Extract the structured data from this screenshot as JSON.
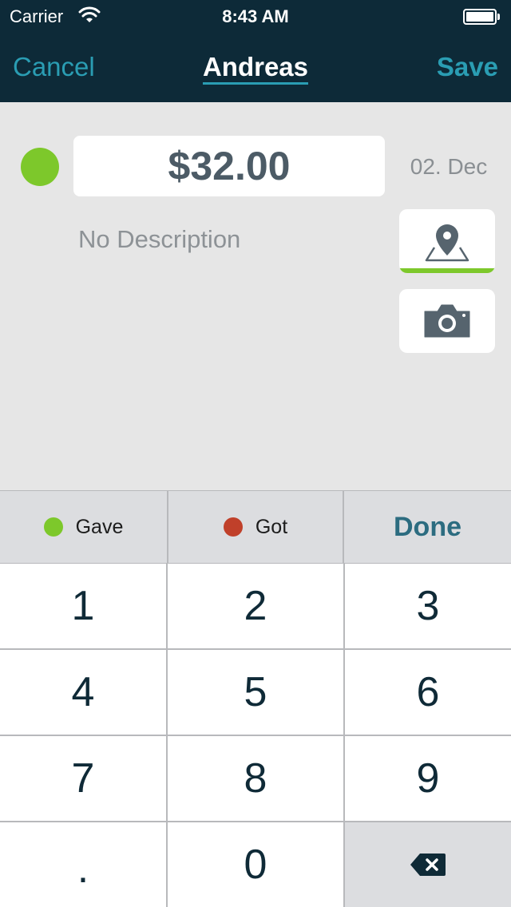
{
  "status_bar": {
    "carrier": "Carrier",
    "time": "8:43 AM",
    "icons": [
      "wifi-icon",
      "battery-icon"
    ]
  },
  "nav": {
    "cancel_label": "Cancel",
    "title": "Andreas",
    "save_label": "Save"
  },
  "entry": {
    "amount": "$32.00",
    "date": "02. Dec",
    "description_placeholder": "No Description",
    "type_indicator_color": "#7dc82b",
    "actions": [
      "location-icon",
      "camera-icon"
    ]
  },
  "segments": {
    "gave_label": "Gave",
    "got_label": "Got",
    "done_label": "Done",
    "gave_color": "#7dc82b",
    "got_color": "#c0402a"
  },
  "keypad": {
    "keys": [
      "1",
      "2",
      "3",
      "4",
      "5",
      "6",
      "7",
      "8",
      "9",
      ".",
      "0"
    ],
    "backspace_icon": "backspace-icon"
  },
  "colors": {
    "header_bg": "#0d2a38",
    "accent": "#2a9db3",
    "green": "#7dc82b"
  }
}
